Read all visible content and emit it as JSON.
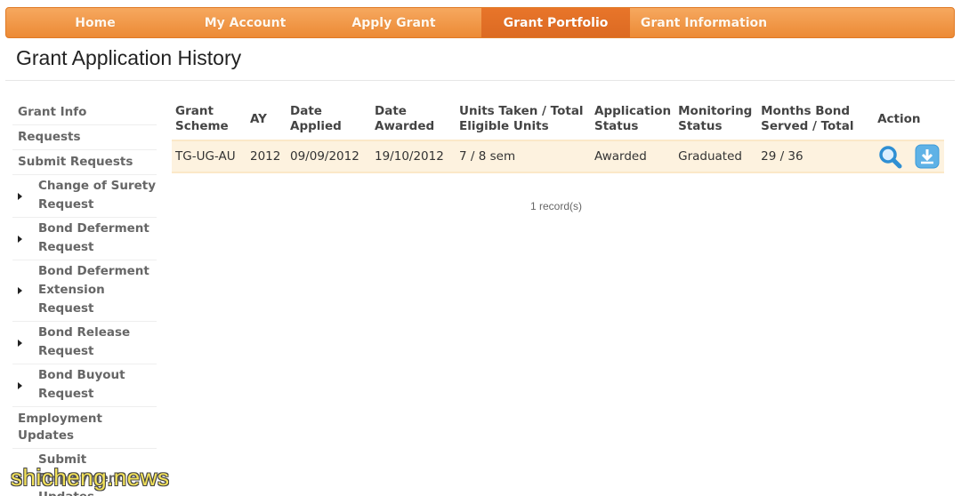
{
  "nav": {
    "items": [
      {
        "label": "Home",
        "active": false
      },
      {
        "label": "My Account",
        "active": false
      },
      {
        "label": "Apply Grant",
        "active": false
      },
      {
        "label": "Grant Portfolio",
        "active": true
      },
      {
        "label": "Grant Information",
        "active": false
      }
    ]
  },
  "page": {
    "title": "Grant Application History"
  },
  "sidebar": {
    "items": [
      {
        "label": "Grant Info"
      },
      {
        "label": "Requests"
      },
      {
        "label": "Submit Requests"
      }
    ],
    "sub_items": [
      {
        "label": "Change of Surety Request"
      },
      {
        "label": "Bond Deferment Request"
      },
      {
        "label": "Bond Deferment Extension Request"
      },
      {
        "label": "Bond Release Request"
      },
      {
        "label": "Bond Buyout Request"
      }
    ],
    "employment": {
      "label": "Employment Updates"
    },
    "employment_sub": {
      "label": "Submit Employment Updates"
    }
  },
  "table": {
    "headers": {
      "scheme": "Grant Scheme",
      "ay": "AY",
      "date_applied": "Date Applied",
      "date_awarded": "Date Awarded",
      "units": "Units Taken / Total Eligible Units",
      "app_status": "Application Status",
      "mon_status": "Monitoring Status",
      "months_bond": "Months Bond Served / Total",
      "action": "Action"
    },
    "rows": [
      {
        "scheme": "TG-UG-AU",
        "ay": "2012",
        "date_applied": "09/09/2012",
        "date_awarded": "19/10/2012",
        "units": "7 / 8 sem",
        "app_status": "Awarded",
        "mon_status": "Graduated",
        "months_bond": "29 / 36"
      }
    ],
    "record_count": "1 record(s)"
  },
  "icons": {
    "view": "magnifier-icon",
    "download": "download-icon"
  },
  "colors": {
    "nav_orange": "#ec8a35",
    "nav_active": "#dc6a22",
    "row_bg": "#fdf2df",
    "icon_blue": "#3a9ad9"
  },
  "watermark": "shicheng.news"
}
